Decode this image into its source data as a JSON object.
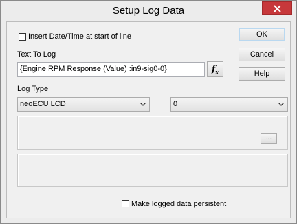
{
  "window": {
    "title": "Setup Log Data"
  },
  "options": {
    "insert_datetime_label": "Insert Date/Time at start of line",
    "insert_datetime_checked": false,
    "persistent_label": "Make logged data persistent",
    "persistent_checked": false
  },
  "text_to_log": {
    "label": "Text To Log",
    "value": "{Engine RPM Response (Value) :in9-sig0-0}",
    "fx_label": "f",
    "fx_sub": "x"
  },
  "log_type": {
    "label": "Log Type",
    "selected": "neoECU LCD",
    "second_selected": "0"
  },
  "buttons": {
    "ok": "OK",
    "cancel": "Cancel",
    "help": "Help",
    "browse": "..."
  },
  "icons": {
    "close": "close-icon",
    "dropdown": "chevron-down-icon"
  },
  "colors": {
    "close_button": "#c7383b",
    "default_button_border": "#3c7fb1"
  }
}
